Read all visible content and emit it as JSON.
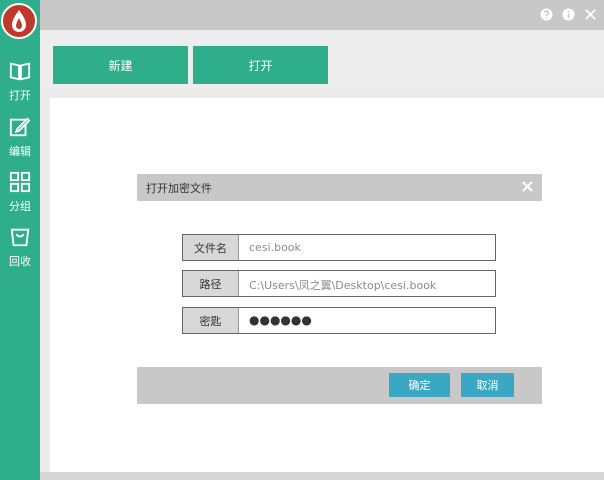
{
  "sidebar": {
    "items": [
      {
        "label": "打开",
        "icon": "book-open-icon"
      },
      {
        "label": "编辑",
        "icon": "edit-icon"
      },
      {
        "label": "分组",
        "icon": "grid-icon"
      },
      {
        "label": "回收",
        "icon": "trash-icon"
      }
    ]
  },
  "topbar": {
    "icons": [
      "help-icon",
      "info-icon",
      "close-icon"
    ]
  },
  "toolbar": {
    "new_label": "新建",
    "open_label": "打开"
  },
  "dialog": {
    "title": "打开加密文件",
    "fields": [
      {
        "label": "文件名",
        "value": "cesi.book"
      },
      {
        "label": "路径",
        "value": "C:\\Users\\凤之翼\\Desktop\\cesi.book"
      },
      {
        "label": "密匙",
        "value": "●●●●●●"
      }
    ],
    "ok_label": "确定",
    "cancel_label": "取消"
  },
  "colors": {
    "accent": "#2fae8b",
    "dialog_button": "#3aa8c4",
    "dialog_chrome": "#c8c8c8"
  }
}
